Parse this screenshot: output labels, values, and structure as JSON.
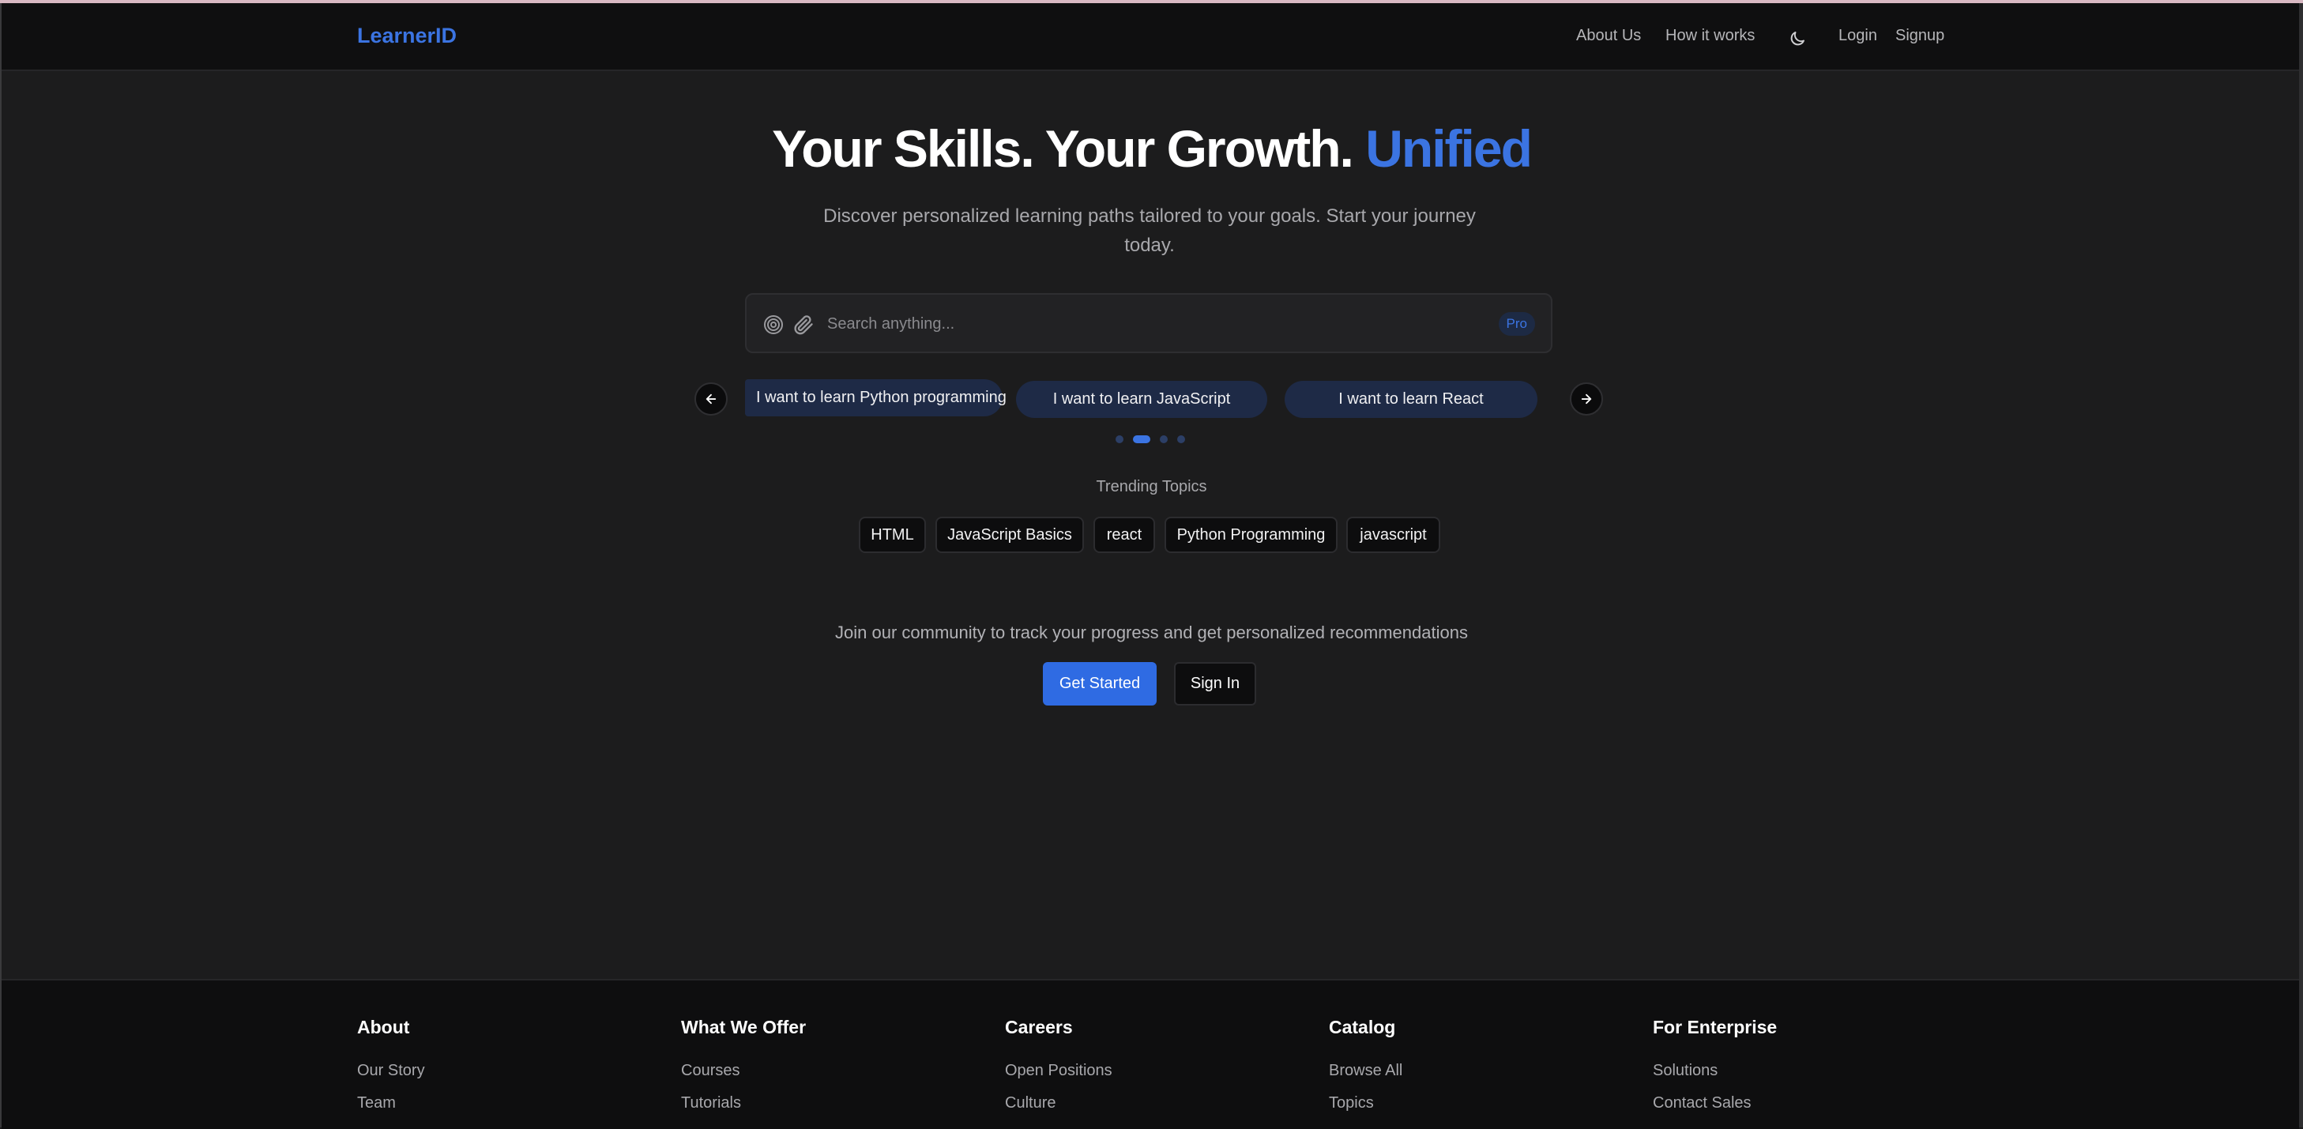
{
  "header": {
    "logo": "LearnerID",
    "nav": {
      "about": "About Us",
      "how": "How it works",
      "login": "Login",
      "signup": "Signup"
    },
    "theme_icon": "moon-icon"
  },
  "hero": {
    "title_main": "Your Skills. Your Growth.",
    "title_accent": "Unified",
    "subtitle": "Discover personalized learning paths tailored to your goals. Start your journey today."
  },
  "search": {
    "placeholder": "Search anything...",
    "value": "",
    "badge": "Pro",
    "icons": [
      "target-icon",
      "paperclip-icon"
    ]
  },
  "carousel": {
    "prompts": [
      "I want to learn Python programming",
      "I want to learn JavaScript",
      "I want to learn React"
    ],
    "page_count": 4,
    "active_page": 2
  },
  "trending": {
    "label": "Trending Topics",
    "topics": [
      "HTML",
      "JavaScript Basics",
      "react",
      "Python Programming",
      "javascript"
    ]
  },
  "cta": {
    "text": "Join our community to track your progress and get personalized recommendations",
    "primary": "Get Started",
    "secondary": "Sign In"
  },
  "footer": {
    "columns": [
      {
        "heading": "About",
        "links": [
          "Our Story",
          "Team"
        ]
      },
      {
        "heading": "What We Offer",
        "links": [
          "Courses",
          "Tutorials"
        ]
      },
      {
        "heading": "Careers",
        "links": [
          "Open Positions",
          "Culture"
        ]
      },
      {
        "heading": "Catalog",
        "links": [
          "Browse All",
          "Topics"
        ]
      },
      {
        "heading": "For Enterprise",
        "links": [
          "Solutions",
          "Contact Sales"
        ]
      }
    ]
  },
  "colors": {
    "accent": "#3b74e2",
    "background": "#1c1c1d",
    "header_bg": "#0f0f10",
    "chip_bg": "#1e2a46"
  }
}
